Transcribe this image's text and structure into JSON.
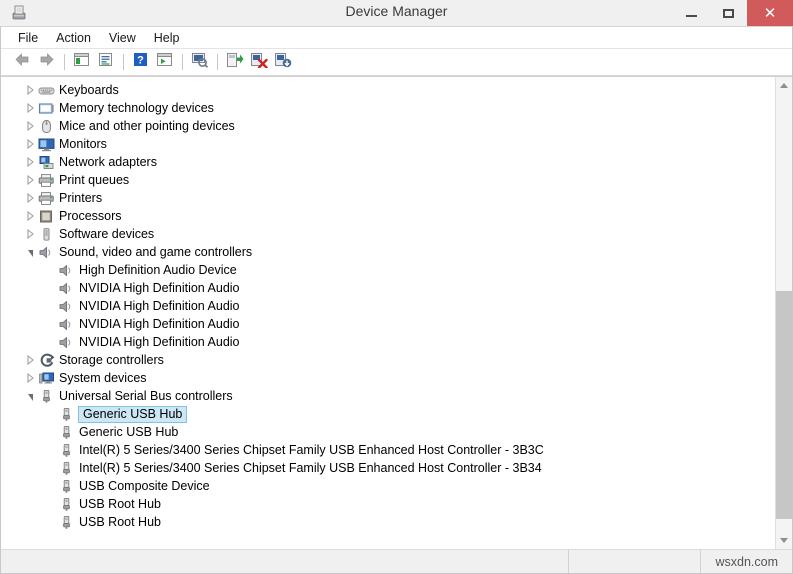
{
  "window": {
    "title": "Device Manager",
    "app_icon": "device-manager-icon",
    "buttons": {
      "minimize": "–",
      "maximize": "□",
      "close": "✕"
    }
  },
  "menubar": {
    "items": [
      {
        "label": "File",
        "name": "menu-file"
      },
      {
        "label": "Action",
        "name": "menu-action"
      },
      {
        "label": "View",
        "name": "menu-view"
      },
      {
        "label": "Help",
        "name": "menu-help"
      }
    ]
  },
  "toolbar": {
    "items": [
      {
        "name": "back-button",
        "icon": "back-arrow-icon",
        "type": "button"
      },
      {
        "name": "forward-button",
        "icon": "forward-arrow-icon",
        "type": "button"
      },
      {
        "name": "toolbar-separator-1",
        "type": "separator"
      },
      {
        "name": "show-hide-console-tree-button",
        "icon": "console-tree-icon",
        "type": "button"
      },
      {
        "name": "properties-button",
        "icon": "properties-icon",
        "type": "button"
      },
      {
        "name": "toolbar-separator-2",
        "type": "separator"
      },
      {
        "name": "help-button",
        "icon": "question-mark-icon",
        "type": "button"
      },
      {
        "name": "show-hide-action-pane-button",
        "icon": "action-pane-icon",
        "type": "button"
      },
      {
        "name": "toolbar-separator-3",
        "type": "separator"
      },
      {
        "name": "scan-for-hardware-changes-button",
        "icon": "scan-hardware-icon",
        "type": "button"
      },
      {
        "name": "toolbar-separator-4",
        "type": "separator"
      },
      {
        "name": "update-driver-button",
        "icon": "update-driver-icon",
        "type": "button"
      },
      {
        "name": "uninstall-device-button",
        "icon": "uninstall-device-icon",
        "type": "button"
      },
      {
        "name": "disable-device-button",
        "icon": "disable-device-icon",
        "type": "button"
      }
    ]
  },
  "tree": {
    "rows": [
      {
        "label": "Keyboards",
        "level": 0,
        "state": "collapsed",
        "icon": "keyboard-icon",
        "selected": false
      },
      {
        "label": "Memory technology devices",
        "level": 0,
        "state": "collapsed",
        "icon": "memory-device-icon",
        "selected": false
      },
      {
        "label": "Mice and other pointing devices",
        "level": 0,
        "state": "collapsed",
        "icon": "mouse-icon",
        "selected": false
      },
      {
        "label": "Monitors",
        "level": 0,
        "state": "collapsed",
        "icon": "monitor-icon",
        "selected": false
      },
      {
        "label": "Network adapters",
        "level": 0,
        "state": "collapsed",
        "icon": "network-adapter-icon",
        "selected": false
      },
      {
        "label": "Print queues",
        "level": 0,
        "state": "collapsed",
        "icon": "printer-icon",
        "selected": false
      },
      {
        "label": "Printers",
        "level": 0,
        "state": "collapsed",
        "icon": "printer-icon",
        "selected": false
      },
      {
        "label": "Processors",
        "level": 0,
        "state": "collapsed",
        "icon": "processor-icon",
        "selected": false
      },
      {
        "label": "Software devices",
        "level": 0,
        "state": "collapsed",
        "icon": "software-device-icon",
        "selected": false
      },
      {
        "label": "Sound, video and game controllers",
        "level": 0,
        "state": "expanded",
        "icon": "speaker-icon",
        "selected": false
      },
      {
        "label": "High Definition Audio Device",
        "level": 1,
        "state": "leaf",
        "icon": "speaker-icon",
        "selected": false
      },
      {
        "label": "NVIDIA High Definition Audio",
        "level": 1,
        "state": "leaf",
        "icon": "speaker-icon",
        "selected": false
      },
      {
        "label": "NVIDIA High Definition Audio",
        "level": 1,
        "state": "leaf",
        "icon": "speaker-icon",
        "selected": false
      },
      {
        "label": "NVIDIA High Definition Audio",
        "level": 1,
        "state": "leaf",
        "icon": "speaker-icon",
        "selected": false
      },
      {
        "label": "NVIDIA High Definition Audio",
        "level": 1,
        "state": "leaf",
        "icon": "speaker-icon",
        "selected": false
      },
      {
        "label": "Storage controllers",
        "level": 0,
        "state": "collapsed",
        "icon": "storage-controller-icon",
        "selected": false
      },
      {
        "label": "System devices",
        "level": 0,
        "state": "collapsed",
        "icon": "system-device-icon",
        "selected": false
      },
      {
        "label": "Universal Serial Bus controllers",
        "level": 0,
        "state": "expanded",
        "icon": "usb-icon",
        "selected": false
      },
      {
        "label": "Generic USB Hub",
        "level": 1,
        "state": "leaf",
        "icon": "usb-icon",
        "selected": true
      },
      {
        "label": "Generic USB Hub",
        "level": 1,
        "state": "leaf",
        "icon": "usb-icon",
        "selected": false
      },
      {
        "label": "Intel(R) 5 Series/3400 Series Chipset Family USB Enhanced Host Controller - 3B3C",
        "level": 1,
        "state": "leaf",
        "icon": "usb-icon",
        "selected": false
      },
      {
        "label": "Intel(R) 5 Series/3400 Series Chipset Family USB Enhanced Host Controller - 3B34",
        "level": 1,
        "state": "leaf",
        "icon": "usb-icon",
        "selected": false
      },
      {
        "label": "USB Composite Device",
        "level": 1,
        "state": "leaf",
        "icon": "usb-icon",
        "selected": false
      },
      {
        "label": "USB Root Hub",
        "level": 1,
        "state": "leaf",
        "icon": "usb-icon",
        "selected": false
      },
      {
        "label": "USB Root Hub",
        "level": 1,
        "state": "leaf",
        "icon": "usb-icon",
        "selected": false
      }
    ]
  },
  "scrollbar": {
    "up_arrow": "scroll-up-arrow",
    "down_arrow": "scroll-down-arrow",
    "thumb_top_pct": 45,
    "thumb_height_pct": 52
  },
  "statusbar": {
    "left": "",
    "middle": "",
    "watermark": "wsxdn.com"
  },
  "colors": {
    "titlebar_bg": "#f0f0f0",
    "close_button": "#d15b5b",
    "selection_fill": "#cce8f4",
    "selection_border": "#7fc3df",
    "tree_bg": "#ffffff",
    "scrollbar_thumb": "#c6c6c6"
  }
}
